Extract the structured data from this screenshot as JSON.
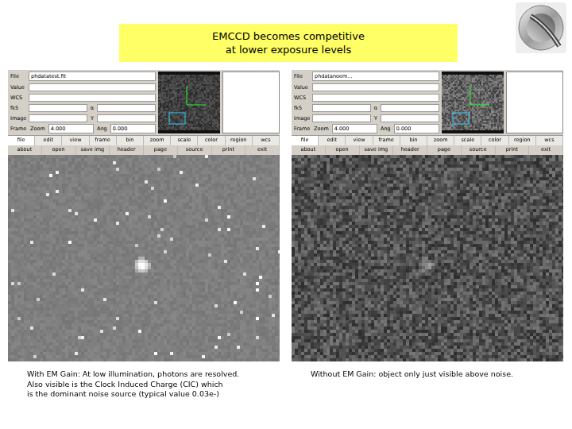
{
  "slide": {
    "title_lines": [
      "EMCCD becomes competitive",
      "at lower exposure levels"
    ]
  },
  "panels": [
    {
      "kind": "em-gain",
      "info": [
        [
          {
            "kind": "label",
            "text": "File"
          },
          {
            "kind": "field",
            "text": "phdatatest.fit"
          }
        ],
        [
          {
            "kind": "label",
            "text": "Value"
          },
          {
            "kind": "field",
            "text": ""
          }
        ],
        [
          {
            "kind": "label",
            "text": "WCS"
          },
          {
            "kind": "field",
            "text": ""
          }
        ],
        [
          {
            "kind": "label",
            "text": "fk5"
          },
          {
            "kind": "field",
            "text": ""
          },
          {
            "kind": "label",
            "text": "α"
          },
          {
            "kind": "field",
            "text": ""
          }
        ],
        [
          {
            "kind": "label",
            "text": "Image"
          },
          {
            "kind": "field",
            "text": ""
          },
          {
            "kind": "label",
            "text": "Y"
          },
          {
            "kind": "field",
            "text": ""
          }
        ],
        [
          {
            "kind": "label",
            "text": "Frame"
          },
          {
            "kind": "label",
            "text": "Zoom"
          },
          {
            "kind": "field",
            "text": "4.000"
          },
          {
            "kind": "label",
            "text": "Ang"
          },
          {
            "kind": "field",
            "text": "0.000"
          }
        ]
      ],
      "menu": [
        {
          "label": "file",
          "selected": true
        },
        {
          "label": "edit",
          "selected": false
        },
        {
          "label": "view",
          "selected": false
        },
        {
          "label": "frame",
          "selected": false
        },
        {
          "label": "bin",
          "selected": false
        },
        {
          "label": "zoom",
          "selected": false
        },
        {
          "label": "scale",
          "selected": false
        },
        {
          "label": "color",
          "selected": false
        },
        {
          "label": "region",
          "selected": false
        },
        {
          "label": "wcs",
          "selected": false
        }
      ],
      "buttons": [
        "about",
        "open",
        "save img",
        "header",
        "page",
        "source",
        "print",
        "exit"
      ],
      "caption_lines": [
        "With EM Gain: At low illumination, photons are resolved.",
        "Also visible is the Clock Induced Charge (CIC) which",
        "is the dominant noise source (typical value 0.03e-)"
      ]
    },
    {
      "kind": "no-gain",
      "info": [
        [
          {
            "kind": "label",
            "text": "File"
          },
          {
            "kind": "field",
            "text": "phdatanoem..."
          }
        ],
        [
          {
            "kind": "label",
            "text": "Value"
          },
          {
            "kind": "field",
            "text": ""
          }
        ],
        [
          {
            "kind": "label",
            "text": "WCS"
          },
          {
            "kind": "field",
            "text": ""
          }
        ],
        [
          {
            "kind": "label",
            "text": "fk5"
          },
          {
            "kind": "field",
            "text": ""
          },
          {
            "kind": "label",
            "text": "α"
          },
          {
            "kind": "field",
            "text": ""
          }
        ],
        [
          {
            "kind": "label",
            "text": "Image"
          },
          {
            "kind": "field",
            "text": ""
          },
          {
            "kind": "label",
            "text": "Y"
          },
          {
            "kind": "field",
            "text": ""
          }
        ],
        [
          {
            "kind": "label",
            "text": "Frame"
          },
          {
            "kind": "label",
            "text": "Zoom"
          },
          {
            "kind": "field",
            "text": "4.000"
          },
          {
            "kind": "label",
            "text": "Ang"
          },
          {
            "kind": "field",
            "text": "0.000"
          }
        ]
      ],
      "menu": [
        {
          "label": "file",
          "selected": true
        },
        {
          "label": "edit",
          "selected": false
        },
        {
          "label": "view",
          "selected": false
        },
        {
          "label": "frame",
          "selected": false
        },
        {
          "label": "bin",
          "selected": false
        },
        {
          "label": "zoom",
          "selected": false
        },
        {
          "label": "scale",
          "selected": false
        },
        {
          "label": "color",
          "selected": false
        },
        {
          "label": "region",
          "selected": false
        },
        {
          "label": "wcs",
          "selected": false
        }
      ],
      "buttons": [
        "about",
        "open",
        "save img",
        "header",
        "page",
        "source",
        "print",
        "exit"
      ],
      "caption_lines": [
        "Without EM Gain: object only just visible above noise."
      ]
    }
  ]
}
